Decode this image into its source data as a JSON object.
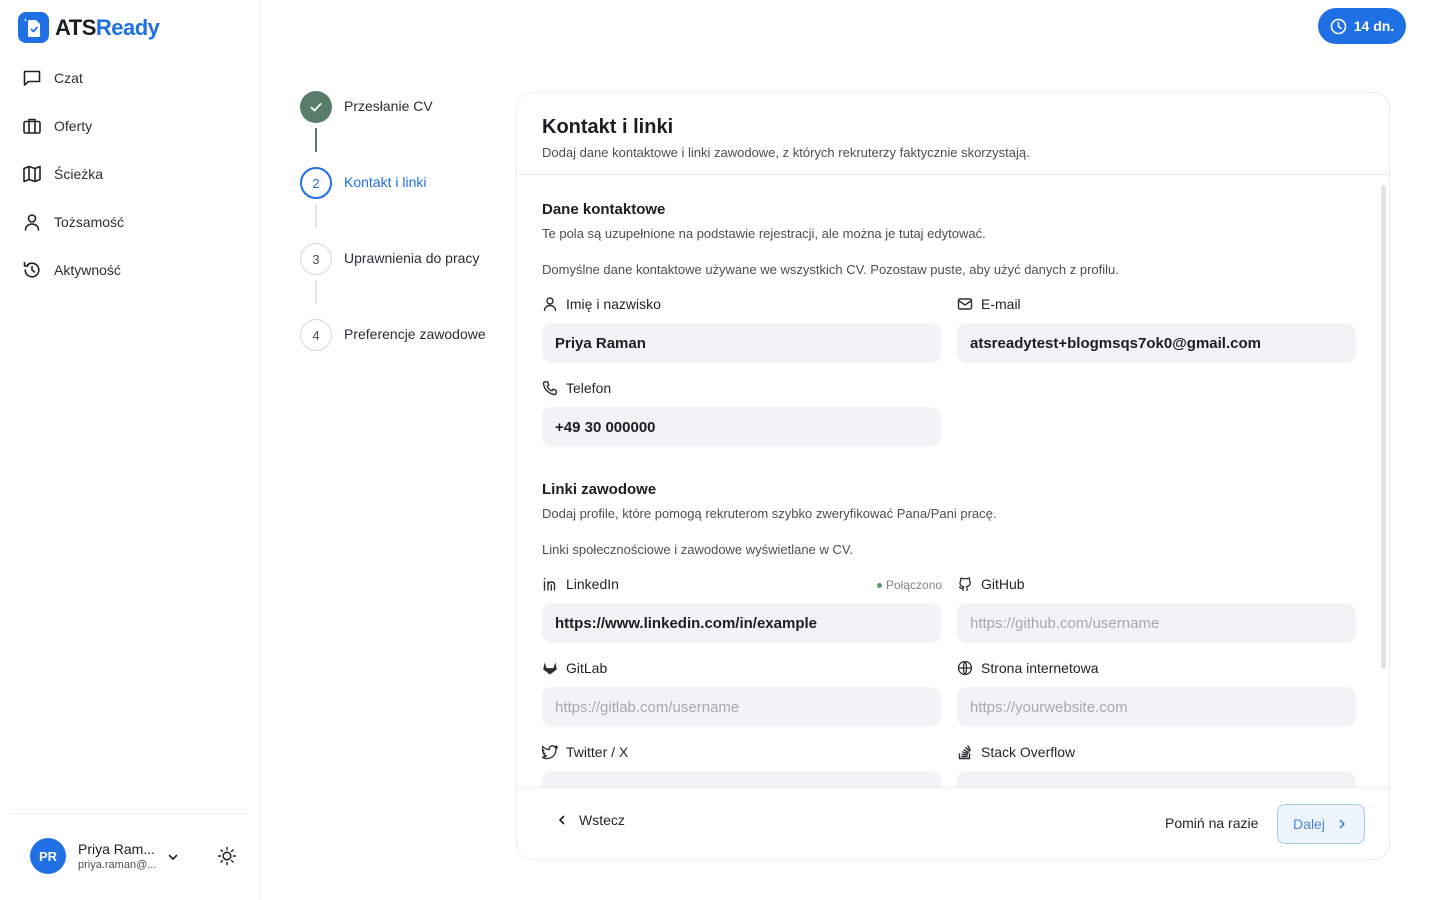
{
  "app": {
    "logo_text_main": "ATS",
    "logo_text_accent": "Ready",
    "accent_color": "#1f6fe5"
  },
  "sidebar": {
    "items": [
      {
        "label": "Czat",
        "icon": "chat-icon"
      },
      {
        "label": "Oferty",
        "icon": "briefcase-icon"
      },
      {
        "label": "Ścieżka",
        "icon": "map-icon"
      },
      {
        "label": "Tożsamość",
        "icon": "user-icon"
      },
      {
        "label": "Aktywność",
        "icon": "history-icon"
      }
    ],
    "user": {
      "initials": "PR",
      "name": "Priya Ram...",
      "email": "priya.raman@..."
    }
  },
  "trial": {
    "label": "14 dn.",
    "icon": "clock-icon"
  },
  "steps": [
    {
      "number": "1",
      "label": "Przesłanie CV",
      "status": "done"
    },
    {
      "number": "2",
      "label": "Kontakt i linki",
      "status": "active"
    },
    {
      "number": "3",
      "label": "Uprawnienia do pracy",
      "status": "todo"
    },
    {
      "number": "4",
      "label": "Preferencje zawodowe",
      "status": "todo"
    }
  ],
  "card": {
    "title": "Kontakt i linki",
    "subtitle": "Dodaj dane kontaktowe i linki zawodowe, z których rekruterzy faktycznie skorzystają.",
    "contact": {
      "title": "Dane kontaktowe",
      "desc1": "Te pola są uzupełnione na podstawie rejestracji, ale można je tutaj edytować.",
      "desc2": "Domyślne dane kontaktowe używane we wszystkich CV. Pozostaw puste, aby użyć danych z profilu.",
      "name_label": "Imię i nazwisko",
      "name_value": "Priya Raman",
      "email_label": "E-mail",
      "email_value": "atsreadytest+blogmsqs7ok0@gmail.com",
      "phone_label": "Telefon",
      "phone_value": "+49 30 000000"
    },
    "links": {
      "title": "Linki zawodowe",
      "desc1": "Dodaj profile, które pomogą rekruterom szybko zweryfikować Pana/Pani pracę.",
      "desc2": "Linki społecznościowe i zawodowe wyświetlane w CV.",
      "linkedin_label": "LinkedIn",
      "linkedin_status": "Połączono",
      "linkedin_value": "https://www.linkedin.com/in/example",
      "github_label": "GitHub",
      "github_placeholder": "https://github.com/username",
      "gitlab_label": "GitLab",
      "gitlab_placeholder": "https://gitlab.com/username",
      "website_label": "Strona internetowa",
      "website_placeholder": "https://yourwebsite.com",
      "twitter_label": "Twitter / X",
      "stackoverflow_label": "Stack Overflow"
    },
    "footer": {
      "back_label": "Wstecz",
      "skip_label": "Pomiń na razie",
      "next_label": "Dalej"
    }
  }
}
